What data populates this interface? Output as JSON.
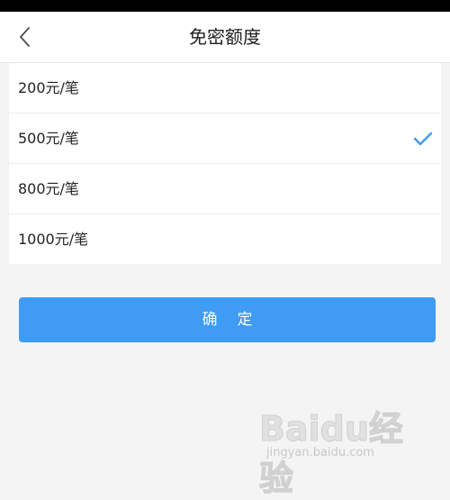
{
  "header": {
    "title": "免密额度",
    "back_icon": "chevron-left-icon"
  },
  "options": [
    {
      "label": "200元/笔",
      "selected": false
    },
    {
      "label": "500元/笔",
      "selected": true
    },
    {
      "label": "800元/笔",
      "selected": false
    },
    {
      "label": "1000元/笔",
      "selected": false
    }
  ],
  "confirm_label": "确定",
  "colors": {
    "accent": "#3f9bf3",
    "background": "#f4f4f4",
    "statusbar": "#000000"
  },
  "watermark": {
    "brand": "Baidu经验",
    "url": "jingyan.baidu.com"
  }
}
